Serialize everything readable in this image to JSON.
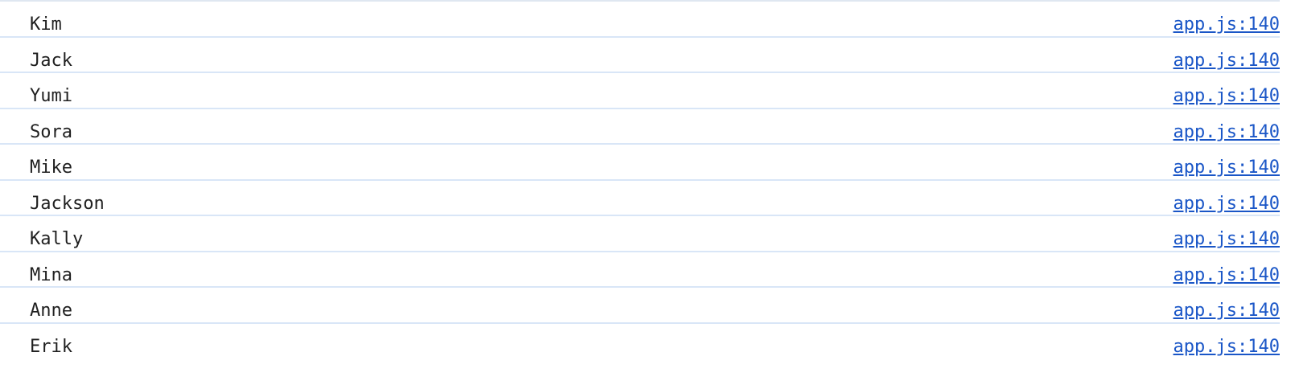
{
  "console": {
    "rows": [
      {
        "message": "Kim",
        "source": "app.js:140"
      },
      {
        "message": "Jack",
        "source": "app.js:140"
      },
      {
        "message": "Yumi",
        "source": "app.js:140"
      },
      {
        "message": "Sora",
        "source": "app.js:140"
      },
      {
        "message": "Mike",
        "source": "app.js:140"
      },
      {
        "message": "Jackson",
        "source": "app.js:140"
      },
      {
        "message": "Kally",
        "source": "app.js:140"
      },
      {
        "message": "Mina",
        "source": "app.js:140"
      },
      {
        "message": "Anne",
        "source": "app.js:140"
      },
      {
        "message": "Erik",
        "source": "app.js:140"
      }
    ]
  },
  "colors": {
    "link": "#1a56c7",
    "divider": "#d9e6f7",
    "text": "#1f1f1f"
  }
}
